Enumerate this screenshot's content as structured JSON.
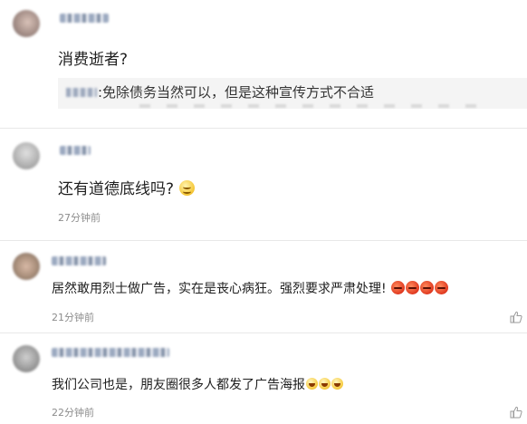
{
  "comments": [
    {
      "text": "消费逝者?",
      "reply": {
        "text": ":免除债务当然可以，但是这种宣传方式不合适"
      }
    },
    {
      "text": "还有道德底线吗?",
      "emoji": "smile-emoji",
      "time": "27分钟前"
    },
    {
      "text": "居然敢用烈士做广告，实在是丧心病狂。强烈要求严肃处理!",
      "emoji": "angry-emoji",
      "time": "21分钟前"
    },
    {
      "text": "我们公司也是，朋友圈很多人都发了广告海报",
      "emoji": "laugh-emoji",
      "time": "22分钟前"
    }
  ],
  "icons": {
    "like": "thumbs-up-icon"
  },
  "colors": {
    "text": "#1f1f1f",
    "time": "#8c8c8c",
    "reply_bg": "#f4f4f4",
    "divider": "#e8e8e8"
  }
}
